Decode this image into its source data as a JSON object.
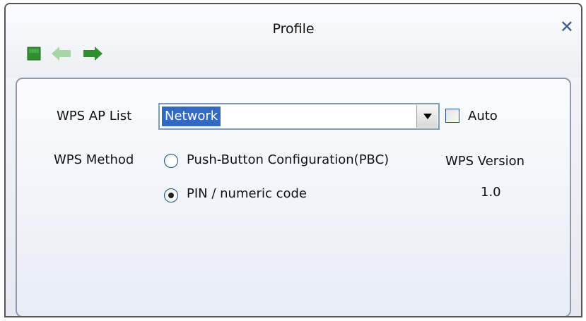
{
  "window": {
    "title": "Profile",
    "close_symbol": "✕"
  },
  "toolbar": {
    "icons": [
      "stop-icon",
      "back-arrow-icon",
      "forward-arrow-icon"
    ],
    "colors": {
      "green": "#3a9a3a",
      "green_disabled": "#a6d6a6"
    }
  },
  "form": {
    "ap_list_label": "WPS AP List",
    "ap_list_value": "Network",
    "auto_label": "Auto",
    "auto_checked": false,
    "method_label": "WPS Method",
    "method_options": [
      {
        "label": "Push-Button Configuration(PBC)",
        "checked": false
      },
      {
        "label": "PIN / numeric code",
        "checked": true
      }
    ],
    "version_label": "WPS Version",
    "version_value": "1.0"
  }
}
